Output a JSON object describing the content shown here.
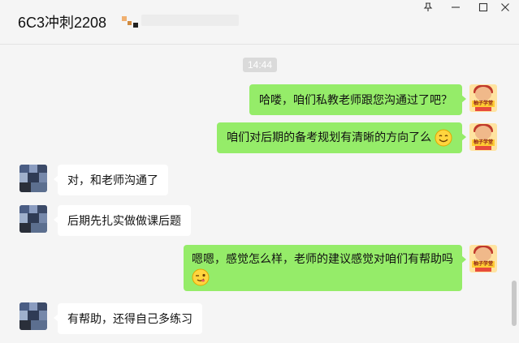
{
  "window": {
    "title": "6C3冲刺2208",
    "pin_icon": "pin-icon",
    "minimize_icon": "minimize-icon",
    "maximize_icon": "maximize-icon",
    "close_icon": "close-icon"
  },
  "chat": {
    "timestamp": "14:44",
    "messages": [
      {
        "side": "sent",
        "text": "哈喽，咱们私教老师跟您沟通过了吧？",
        "emoji": ""
      },
      {
        "side": "sent",
        "text": "咱们对后期的备考规划有清晰的方向了么",
        "emoji": "smile-emoji"
      },
      {
        "side": "recv",
        "text": "对，和老师沟通了",
        "emoji": ""
      },
      {
        "side": "recv",
        "text": "后期先扎实做做课后题",
        "emoji": ""
      },
      {
        "side": "sent",
        "text": "嗯嗯，感觉怎么样，老师的建议感觉对咱们有帮助吗",
        "emoji": "wink-emoji"
      },
      {
        "side": "recv",
        "text": "有帮助，还得自己多练习",
        "emoji": ""
      }
    ]
  },
  "avatars": {
    "me_badge": "柚子学堂"
  },
  "colors": {
    "sent_bubble": "#95ec69",
    "recv_bubble": "#ffffff",
    "background": "#f5f5f5"
  }
}
